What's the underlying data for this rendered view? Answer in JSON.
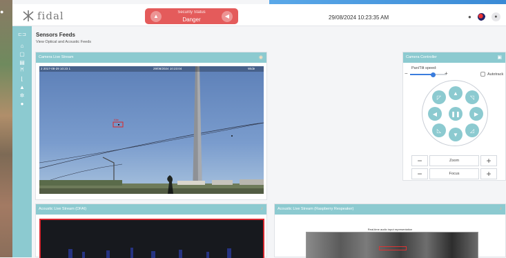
{
  "header": {
    "logo_text": "fidal",
    "alert_title": "Security Status",
    "alert_status": "Danger",
    "datetime": "29/08/2024 10:23:35 AM"
  },
  "page": {
    "title": "Sensors Feeds",
    "subtitle": "View Optical and Acoustic Feeds"
  },
  "camera": {
    "title": "Camera Live Stream",
    "osd_left": "2 2017-08-29 10:23 1",
    "osd_center": "29/08/2024 10:23:04",
    "osd_right": "Wide",
    "bbox_label": "Kite"
  },
  "controller": {
    "title": "Camera Controller",
    "speed_label": "Pan/Tilt speed:",
    "speed_value": 0.65,
    "autotrack_label": "Autotrack",
    "zoom_label": "Zoom",
    "focus_label": "Focus"
  },
  "acoustic1": {
    "title": "Acoustic Live Stream (DFAI)"
  },
  "acoustic2": {
    "title": "Acoustic Live Stream (Raspberry Respeaker)",
    "plot_title": "Real-time audio input representation"
  },
  "colors": {
    "accent": "#8ccad0",
    "danger": "#e45b5b",
    "primary": "#3b7ddd"
  }
}
